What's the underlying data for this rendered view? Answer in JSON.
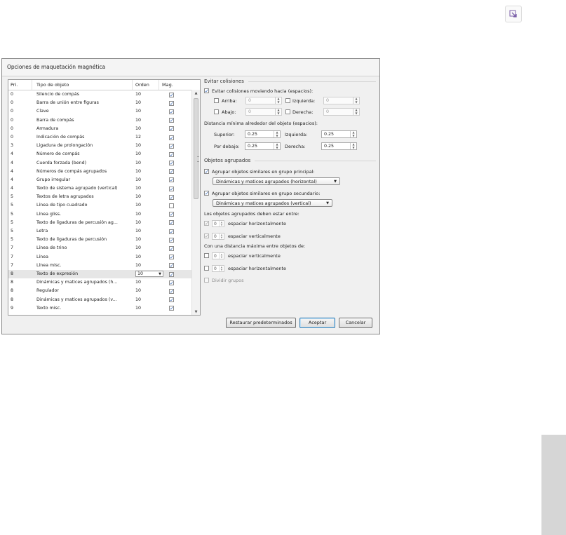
{
  "dialog": {
    "title": "Opciones de maquetación magnética"
  },
  "list": {
    "headers": {
      "pri": "Pri.",
      "tipo": "Tipo de objeto",
      "orden": "Orden",
      "mag": "Mag."
    },
    "rows": [
      {
        "pri": "0",
        "tipo": "Silencio de compás",
        "orden": "10",
        "mag": true
      },
      {
        "pri": "0",
        "tipo": "Barra de unión entre figuras",
        "orden": "10",
        "mag": true
      },
      {
        "pri": "0",
        "tipo": "Clave",
        "orden": "10",
        "mag": true
      },
      {
        "pri": "0",
        "tipo": "Barra de compás",
        "orden": "10",
        "mag": true
      },
      {
        "pri": "0",
        "tipo": "Armadura",
        "orden": "10",
        "mag": true
      },
      {
        "pri": "0",
        "tipo": "Indicación de compás",
        "orden": "12",
        "mag": true
      },
      {
        "pri": "3",
        "tipo": "Ligadura de prolongación",
        "orden": "10",
        "mag": true
      },
      {
        "pri": "4",
        "tipo": "Número de compás",
        "orden": "10",
        "mag": true
      },
      {
        "pri": "4",
        "tipo": "Cuerda forzada (bend)",
        "orden": "10",
        "mag": true
      },
      {
        "pri": "4",
        "tipo": "Números de compás agrupados",
        "orden": "10",
        "mag": true
      },
      {
        "pri": "4",
        "tipo": "Grupo irregular",
        "orden": "10",
        "mag": true
      },
      {
        "pri": "4",
        "tipo": "Texto de sistema agrupado (vertical)",
        "orden": "10",
        "mag": true
      },
      {
        "pri": "5",
        "tipo": "Textos de letra agrupados",
        "orden": "10",
        "mag": true
      },
      {
        "pri": "5",
        "tipo": "Línea de tipo cuadrado",
        "orden": "10",
        "mag": false
      },
      {
        "pri": "5",
        "tipo": "Línea gliss.",
        "orden": "10",
        "mag": true
      },
      {
        "pri": "5",
        "tipo": "Texto de ligaduras de percusión ag...",
        "orden": "10",
        "mag": true
      },
      {
        "pri": "5",
        "tipo": "Letra",
        "orden": "10",
        "mag": true
      },
      {
        "pri": "5",
        "tipo": "Texto de ligaduras de percusión",
        "orden": "10",
        "mag": true
      },
      {
        "pri": "7",
        "tipo": "Línea de trino",
        "orden": "10",
        "mag": true
      },
      {
        "pri": "7",
        "tipo": "Línea",
        "orden": "10",
        "mag": true
      },
      {
        "pri": "7",
        "tipo": "Línea misc.",
        "orden": "10",
        "mag": true
      },
      {
        "pri": "8",
        "tipo": "Texto de expresión",
        "orden": "10",
        "mag": true,
        "selected": true
      },
      {
        "pri": "8",
        "tipo": "Dinámicas y matices agrupados (h...",
        "orden": "10",
        "mag": true
      },
      {
        "pri": "8",
        "tipo": "Regulador",
        "orden": "10",
        "mag": true
      },
      {
        "pri": "8",
        "tipo": "Dinámicas y matices agrupados (v...",
        "orden": "10",
        "mag": true
      },
      {
        "pri": "9",
        "tipo": "Texto misc.",
        "orden": "10",
        "mag": true
      }
    ]
  },
  "collisions": {
    "title": "Evitar colisiones",
    "avoid_label": "Evitar colisiones moviendo hacia (espacios):",
    "avoid_checked": true,
    "arriba": {
      "label": "Arriba:",
      "value": "0",
      "checked": false
    },
    "izquierda": {
      "label": "Izquierda:",
      "value": "0",
      "checked": false
    },
    "abajo": {
      "label": "Abajo:",
      "value": "0",
      "checked": false
    },
    "derecha": {
      "label": "Derecha:",
      "value": "0",
      "checked": false
    },
    "min_distance_label": "Distancia mínima alrededor del objeto (espacios):",
    "superior": {
      "label": "Superior:",
      "value": "0.25"
    },
    "izquierda2": {
      "label": "Izquierda:",
      "value": "0.25"
    },
    "por_debajo": {
      "label": "Por debajo:",
      "value": "0.25"
    },
    "derecha2": {
      "label": "Derecha:",
      "value": "0.25"
    }
  },
  "grouped": {
    "title": "Objetos agrupados",
    "primary_label": "Agrupar objetos similares en grupo principal:",
    "primary_checked": true,
    "primary_select": "Dinámicas y matices agrupados (horizontal)",
    "secondary_label": "Agrupar objetos similares en grupo secundario:",
    "secondary_checked": true,
    "secondary_select": "Dinámicas y matices agrupados (vertical)",
    "between_label": "Los objetos agrupados deben estar entre:",
    "between_h": {
      "value": "0",
      "label": "espaciar horizontalmente"
    },
    "between_v": {
      "value": "0",
      "label": "espaciar verticalmente"
    },
    "max_label": "Con una distancia máxima entre objetos de:",
    "max_v": {
      "value": "0",
      "label": "espaciar verticalmente"
    },
    "max_h": {
      "value": "0",
      "label": "espaciar horizontalmente"
    },
    "split_label": "Dividir grupos"
  },
  "buttons": {
    "restore": "Restaurar predeterminados",
    "accept": "Aceptar",
    "cancel": "Cancelar"
  },
  "icons": {
    "corner": "external-link-icon"
  }
}
